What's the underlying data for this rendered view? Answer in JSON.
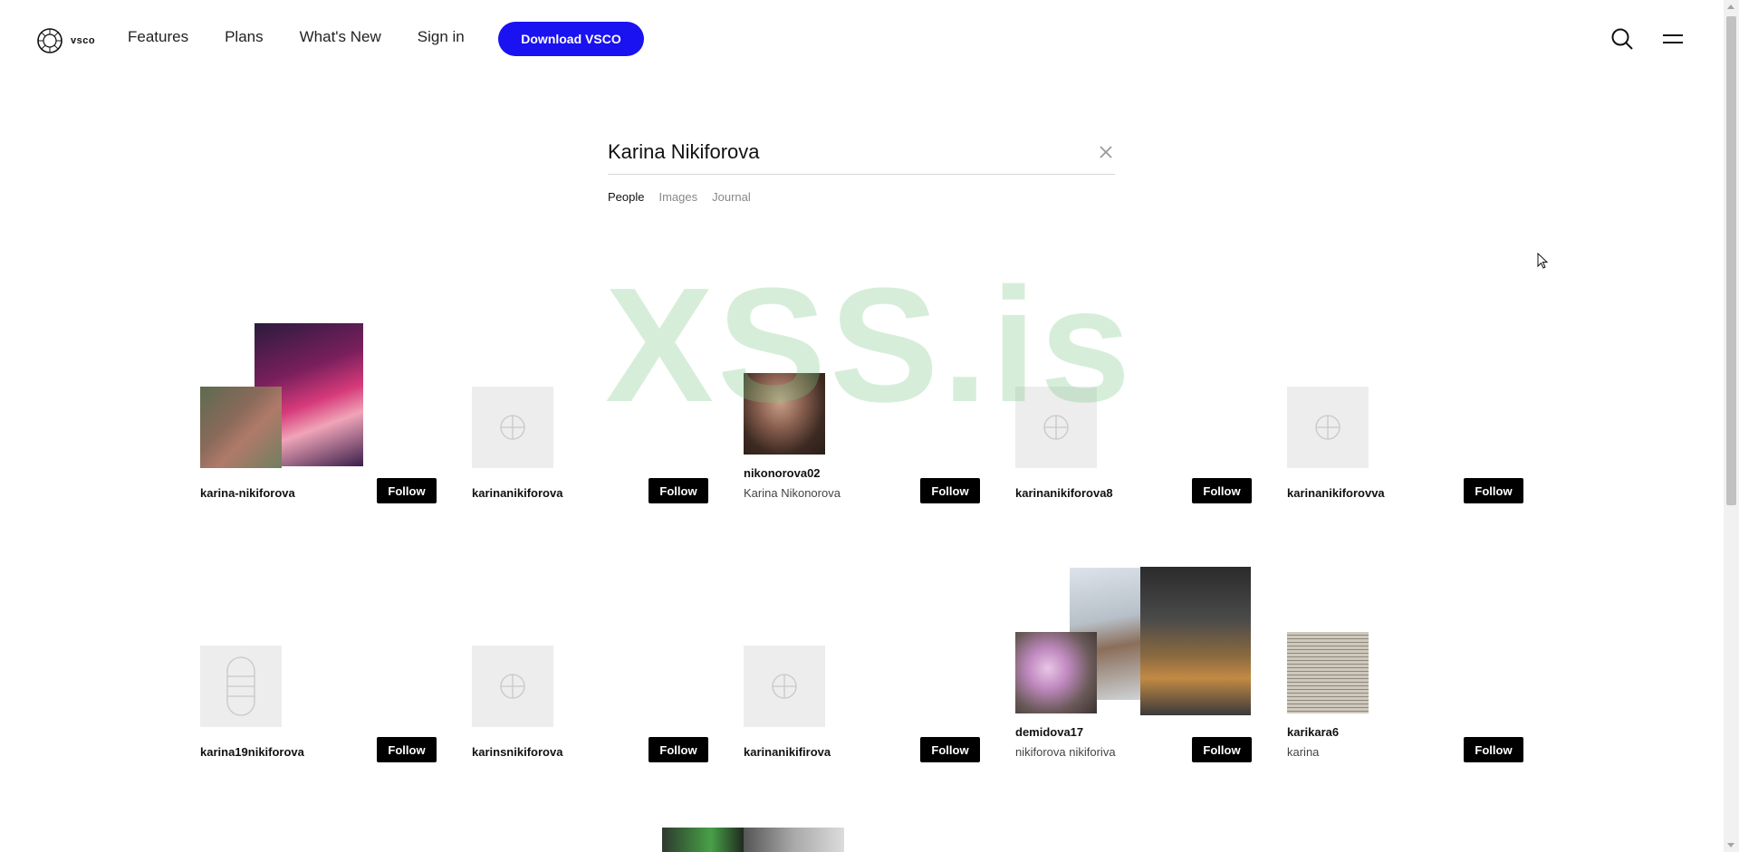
{
  "header": {
    "logo_text": "vsco",
    "nav": [
      "Features",
      "Plans",
      "What's New",
      "Sign in"
    ],
    "download_label": "Download VSCO"
  },
  "search": {
    "query": "Karina Nikiforova",
    "tabs": [
      "People",
      "Images",
      "Journal"
    ],
    "active_tab": "People"
  },
  "watermark": "XSS.is",
  "colors": {
    "accent": "#1a12f0",
    "follow_bg": "#000000"
  },
  "results": [
    {
      "username": "karina-nikiforova",
      "subtitle": "",
      "follow_label": "Follow",
      "avatar": "photo-collage"
    },
    {
      "username": "karinanikiforova",
      "subtitle": "",
      "follow_label": "Follow",
      "avatar": "placeholder"
    },
    {
      "username": "nikonorova02",
      "subtitle": "Karina Nikonorova",
      "follow_label": "Follow",
      "avatar": "photo"
    },
    {
      "username": "karinanikiforova8",
      "subtitle": "",
      "follow_label": "Follow",
      "avatar": "placeholder"
    },
    {
      "username": "karinanikiforovva",
      "subtitle": "",
      "follow_label": "Follow",
      "avatar": "placeholder"
    },
    {
      "username": "karina19nikiforova",
      "subtitle": "",
      "follow_label": "Follow",
      "avatar": "placeholder-capsule"
    },
    {
      "username": "karinsnikiforova",
      "subtitle": "",
      "follow_label": "Follow",
      "avatar": "placeholder"
    },
    {
      "username": "karinanikifirova",
      "subtitle": "",
      "follow_label": "Follow",
      "avatar": "placeholder"
    },
    {
      "username": "demidova17",
      "subtitle": "nikiforova nikiforiva",
      "follow_label": "Follow",
      "avatar": "photo-collage"
    },
    {
      "username": "karikara6",
      "subtitle": "karina",
      "follow_label": "Follow",
      "avatar": "photo"
    }
  ]
}
